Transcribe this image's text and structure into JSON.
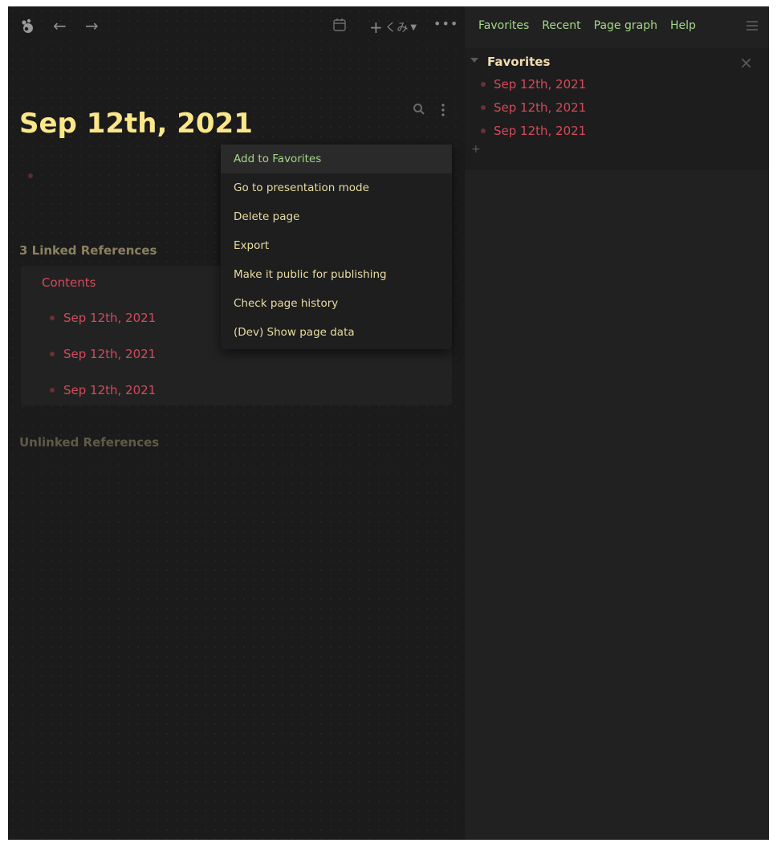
{
  "header": {
    "workspace_label": "くみ",
    "more_label": "•••"
  },
  "page": {
    "title": "Sep 12th, 2021"
  },
  "linked": {
    "title": "3 Linked References",
    "card_title": "Contents",
    "items": [
      "Sep 12th, 2021",
      "Sep 12th, 2021",
      "Sep 12th, 2021"
    ]
  },
  "unlinked": {
    "title": "Unlinked References"
  },
  "menu": {
    "items": [
      "Add to Favorites",
      "Go to presentation mode",
      "Delete page",
      "Export",
      "Make it public for publishing",
      "Check page history",
      "(Dev) Show page data"
    ]
  },
  "sidebar": {
    "tabs": [
      "Favorites",
      "Recent",
      "Page graph",
      "Help"
    ],
    "favorites_title": "Favorites",
    "favorites": [
      "Sep 12th, 2021",
      "Sep 12th, 2021",
      "Sep 12th, 2021"
    ],
    "add_label": "+"
  },
  "colors": {
    "background": "#1b1b1b",
    "title": "#fbe68a",
    "link": "#d34a5b",
    "accent": "#a5d88a",
    "sidebar_bg": "#212121"
  }
}
